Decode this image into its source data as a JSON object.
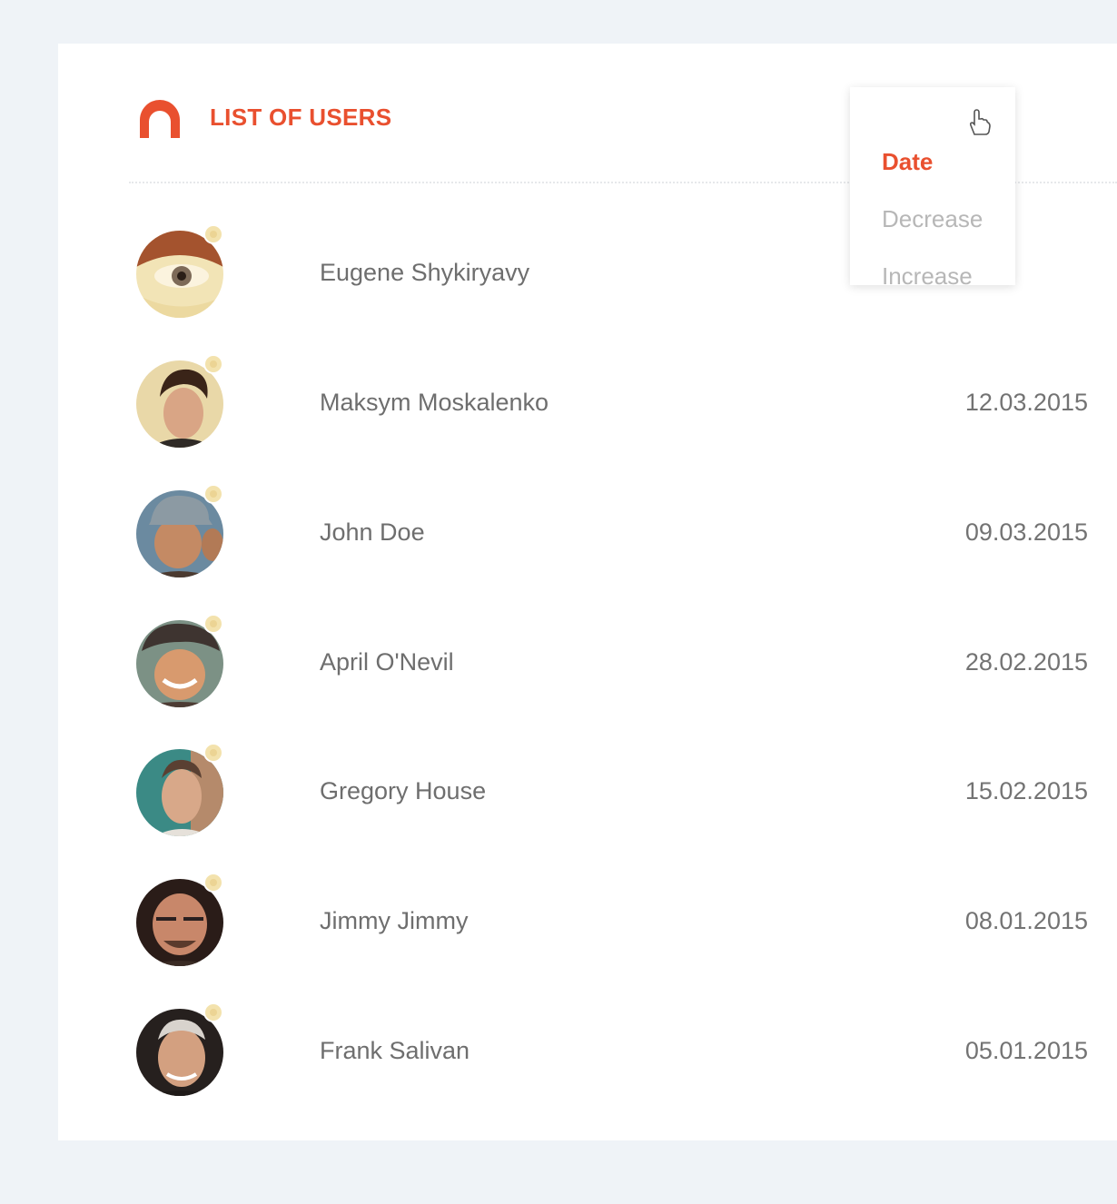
{
  "header": {
    "title": "LIST OF USERS",
    "icon": "user-icon"
  },
  "sort": {
    "label": "Date",
    "options": [
      "Decrease",
      "Increase"
    ]
  },
  "users": [
    {
      "name": "Eugene Shykiryavy",
      "date": ""
    },
    {
      "name": "Maksym Moskalenko",
      "date": "12.03.2015"
    },
    {
      "name": "John Doe",
      "date": "09.03.2015"
    },
    {
      "name": "April O'Nevil",
      "date": "28.02.2015"
    },
    {
      "name": "Gregory House",
      "date": "15.02.2015"
    },
    {
      "name": "Jimmy Jimmy",
      "date": "08.01.2015"
    },
    {
      "name": "Frank Salivan",
      "date": "05.01.2015"
    }
  ],
  "colors": {
    "accent": "#e9502f",
    "background": "#eff3f7",
    "card": "#ffffff",
    "text": "#6e6e6e",
    "muted": "#b7b7b7",
    "badge": "#f3e2ad"
  }
}
